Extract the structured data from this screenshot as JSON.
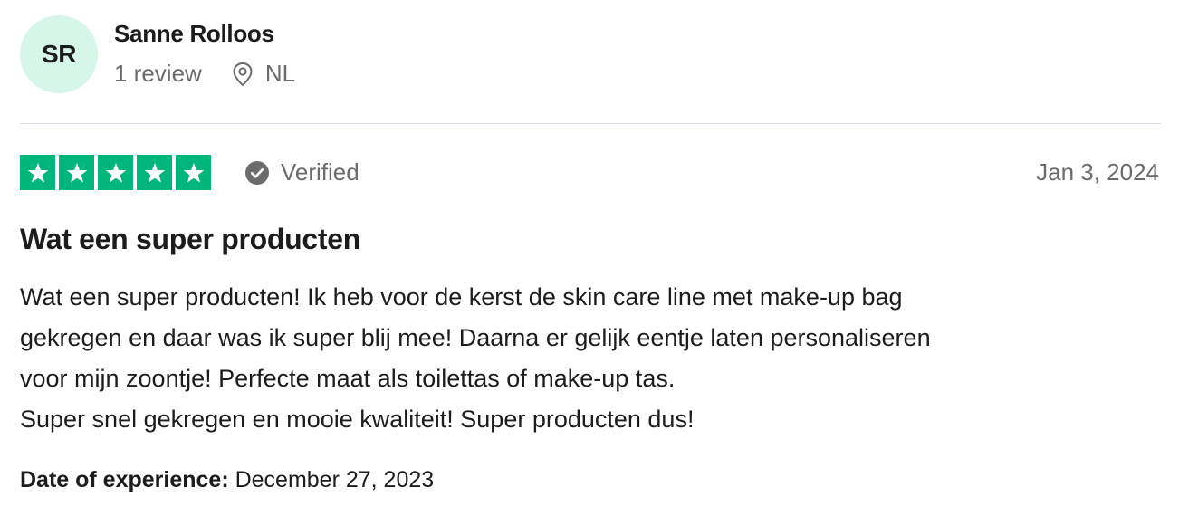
{
  "reviewer": {
    "initials": "SR",
    "name": "Sanne Rolloos",
    "review_count": "1 review",
    "country": "NL",
    "avatar_color": "#d6f6ea"
  },
  "rating": {
    "stars": 5,
    "max_stars": 5,
    "star_color": "#00b67a"
  },
  "verified_label": "Verified",
  "review_date": "Jan 3, 2024",
  "review": {
    "title": "Wat een super producten",
    "body_lines": [
      "Wat een super producten! Ik heb voor de kerst de skin care line met make-up bag",
      "gekregen en daar was ik super blij mee! Daarna er gelijk eentje laten personaliseren",
      "voor mijn zoontje! Perfecte maat als toilettas of make-up tas.",
      "Super snel gekregen en mooie kwaliteit! Super producten dus!"
    ]
  },
  "experience": {
    "label": "Date of experience:",
    "value": "December 27, 2023"
  },
  "icons": {
    "location": "location-pin-icon",
    "verified": "check-circle-icon",
    "star": "star-icon"
  }
}
